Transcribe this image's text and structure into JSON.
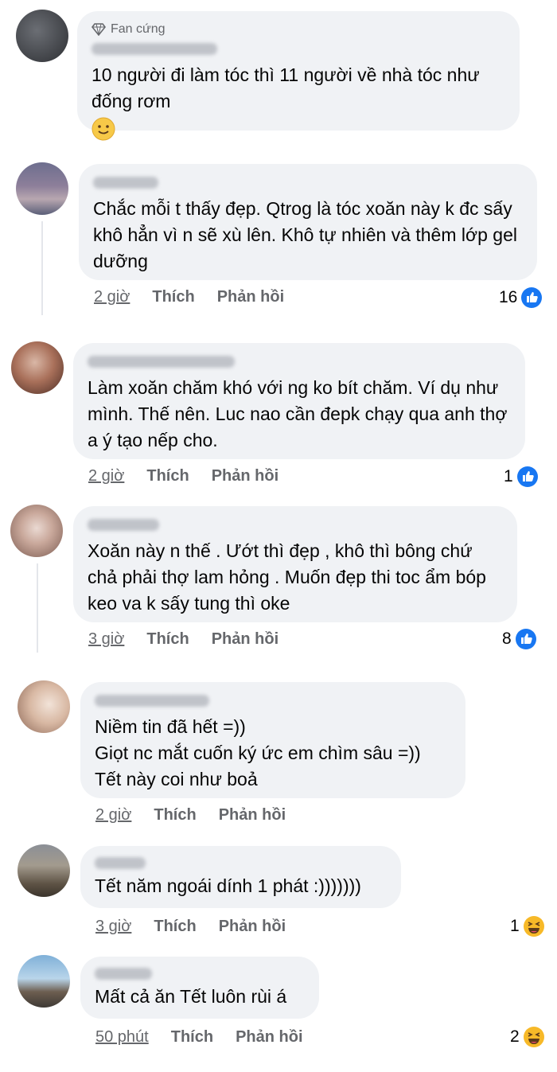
{
  "comments": [
    {
      "badge": "Fan cứng",
      "text": "10 người đi làm tóc thì 11 người về nhà tóc như đống rơm",
      "emoji": "slight-smile-emoji"
    },
    {
      "text": "Chắc mỗi t thấy đẹp. Qtrog là tóc xoăn này k đc sấy khô hẳn vì n sẽ xù lên. Khô tự nhiên và thêm lớp gel dưỡng",
      "time": "2 giờ",
      "like": "Thích",
      "reply": "Phản hồi",
      "reactions": "16",
      "reaction_type": "like"
    },
    {
      "text": "Làm xoăn chăm khó với ng ko bít chăm. Ví dụ như mình. Thế nên. Luc nao cần đepk chạy qua anh thợ a ý tạo nếp cho.",
      "time": "2 giờ",
      "like": "Thích",
      "reply": "Phản hồi",
      "reactions": "1",
      "reaction_type": "like"
    },
    {
      "text": "Xoăn này n thế . Ướt thì đẹp , khô thì bông chứ chả phải thợ lam hỏng . Muốn đẹp thi toc ẩm bóp keo va k sấy tung thì oke",
      "time": "3 giờ",
      "like": "Thích",
      "reply": "Phản hồi",
      "reactions": "8",
      "reaction_type": "like"
    },
    {
      "text": "Niềm tin đã hết =))\nGiọt nc mắt cuốn ký ức em chìm sâu =))\nTết này coi như boả",
      "time": "2 giờ",
      "like": "Thích",
      "reply": "Phản hồi"
    },
    {
      "text": "Tết năm ngoái dính 1 phát :)))))))",
      "time": "3 giờ",
      "like": "Thích",
      "reply": "Phản hồi",
      "reactions": "1",
      "reaction_type": "haha"
    },
    {
      "text": "Mất cả ăn Tết luôn rùi á",
      "time": "50 phút",
      "like": "Thích",
      "reply": "Phản hồi",
      "reactions": "2",
      "reaction_type": "haha"
    }
  ],
  "colors": {
    "bubble": "#f0f2f5",
    "like_blue": "#1877f2",
    "haha_yellow": "#f7b928",
    "muted": "#65676b"
  }
}
